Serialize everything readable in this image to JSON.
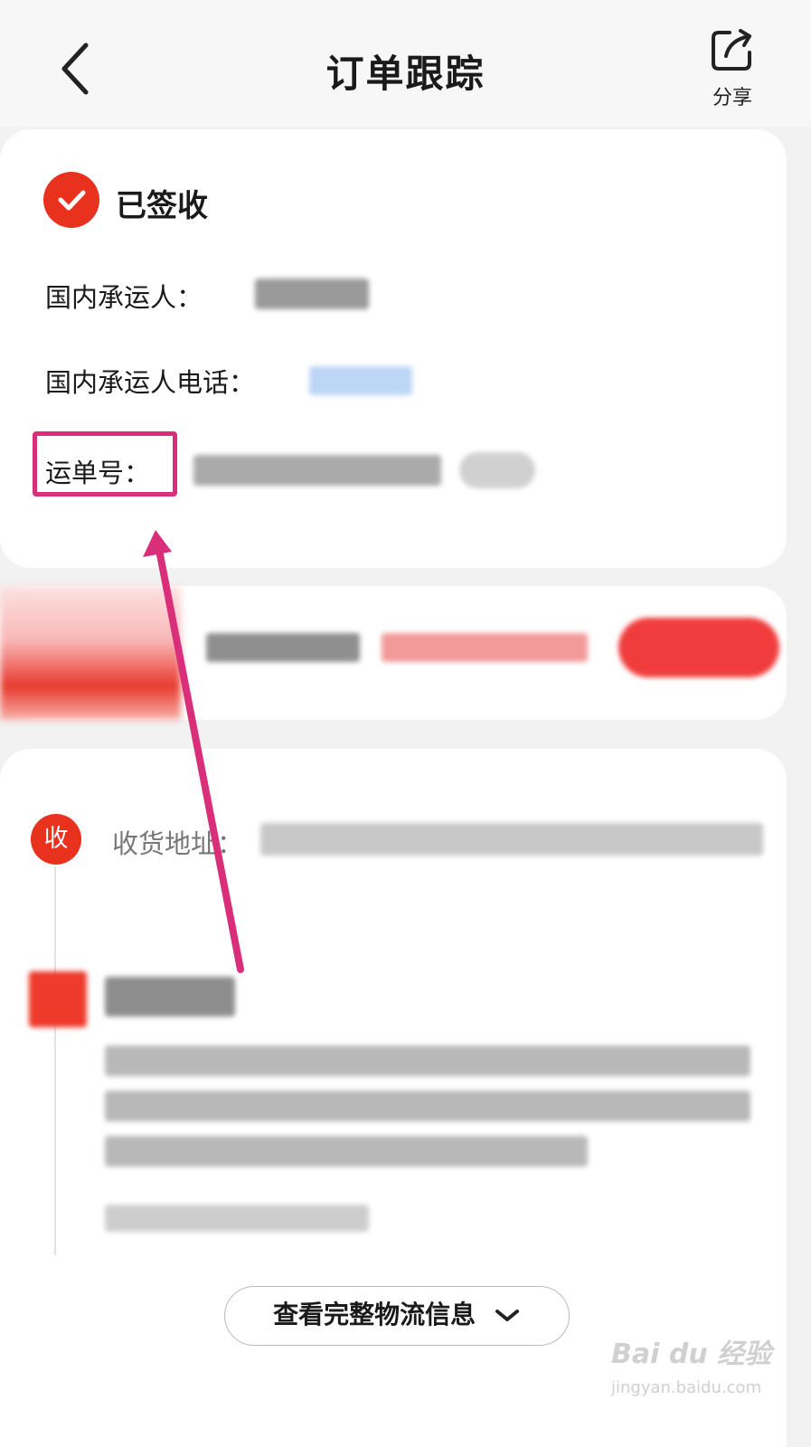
{
  "header": {
    "title": "订单跟踪",
    "share_label": "分享"
  },
  "status": {
    "text": "已签收",
    "fields": {
      "carrier_label": "国内承运人：",
      "carrier_phone_label": "国内承运人电话：",
      "tracking_label": "运单号："
    }
  },
  "logistics": {
    "receive_icon_text": "收",
    "address_label": "收货地址："
  },
  "expand_button": {
    "label": "查看完整物流信息"
  },
  "watermark": {
    "brand": "Bai du 经验",
    "url": "jingyan.baidu.com"
  },
  "colors": {
    "accent": "#e8321e",
    "annotation": "#d92f7a"
  }
}
